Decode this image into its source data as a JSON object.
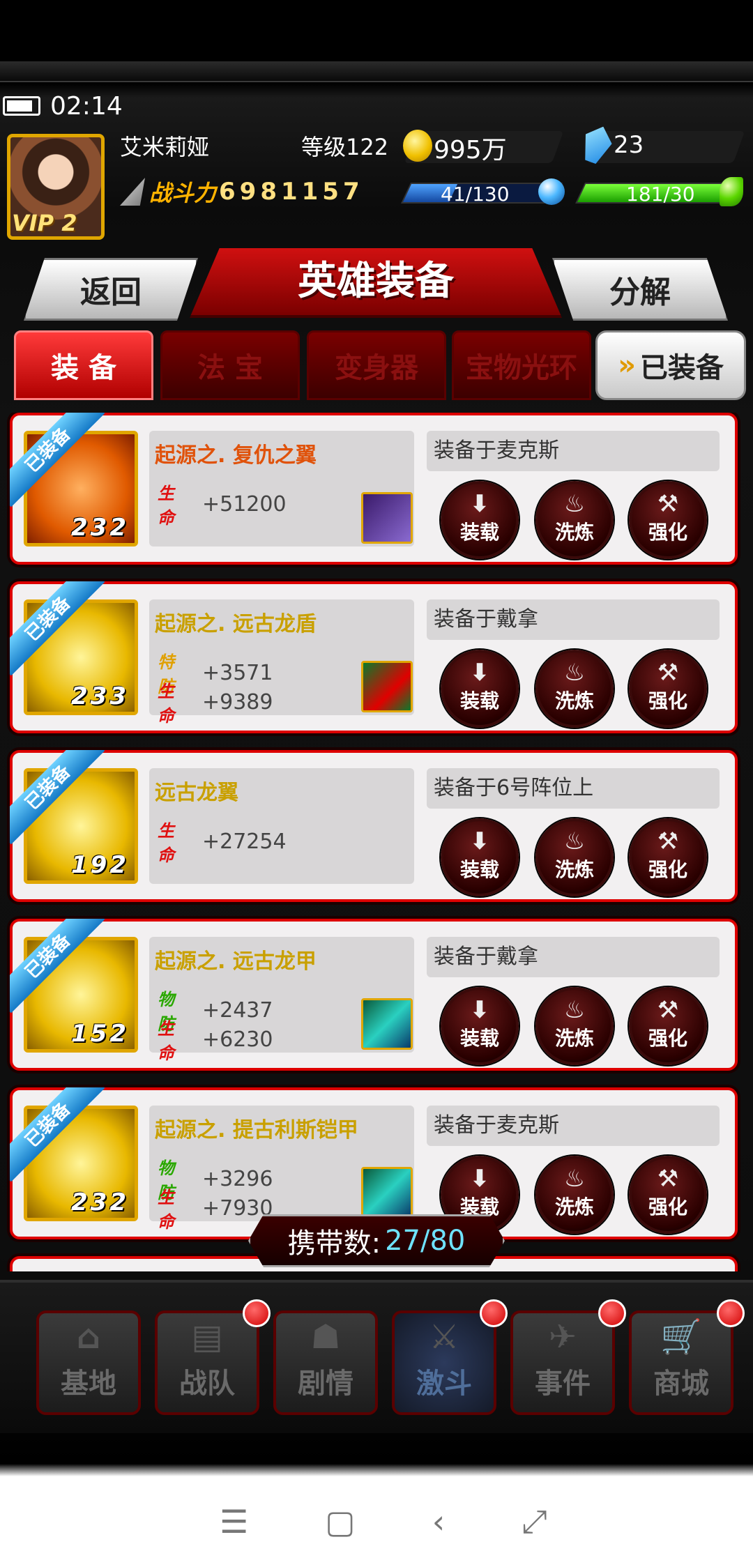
{
  "status": {
    "time": "02:14"
  },
  "player": {
    "name": "艾米莉娅",
    "level": "等级122",
    "vip": "VIP 2",
    "gold": "995万",
    "gems": "23",
    "power_label": "战斗力",
    "power_value": "6981157",
    "energy": "41/130",
    "energy_fraction": 0.31,
    "stamina": "181/30",
    "stamina_fraction": 1.0
  },
  "header": {
    "title": "英雄装备",
    "back": "返回",
    "decompose": "分解"
  },
  "tabs": [
    "装 备",
    "法 宝",
    "变身器",
    "宝物光环"
  ],
  "tab_equipped": "已装备",
  "actions": {
    "load": "装载",
    "wash": "洗炼",
    "strengthen": "强化"
  },
  "items": [
    {
      "badge": "已装备",
      "level": "232",
      "name": "起源之. 复仇之翼",
      "name_color": "#e0520a",
      "stats": [
        {
          "key": "生命",
          "type": "hp",
          "value": "+51200"
        }
      ],
      "equipped_on": "装备于麦克斯"
    },
    {
      "badge": "已装备",
      "level": "233",
      "name": "起源之. 远古龙盾",
      "name_color": "#c9a000",
      "stats": [
        {
          "key": "特防",
          "type": "sp",
          "value": "+3571"
        },
        {
          "key": "生命",
          "type": "hp",
          "value": "+9389"
        }
      ],
      "equipped_on": "装备于戴拿"
    },
    {
      "badge": "已装备",
      "level": "192",
      "name": "远古龙翼",
      "name_color": "#c9a000",
      "stats": [
        {
          "key": "生命",
          "type": "hp",
          "value": "+27254"
        }
      ],
      "equipped_on": "装备于6号阵位上"
    },
    {
      "badge": "已装备",
      "level": "152",
      "name": "起源之. 远古龙甲",
      "name_color": "#c9a000",
      "stats": [
        {
          "key": "物防",
          "type": "pd",
          "value": "+2437"
        },
        {
          "key": "生命",
          "type": "hp",
          "value": "+6230"
        }
      ],
      "equipped_on": "装备于戴拿"
    },
    {
      "badge": "已装备",
      "level": "232",
      "name": "起源之. 提古利斯铠甲",
      "name_color": "#c9a000",
      "stats": [
        {
          "key": "物防",
          "type": "pd",
          "value": "+3296"
        },
        {
          "key": "生命",
          "type": "hp",
          "value": "+7930"
        }
      ],
      "equipped_on": "装备于麦克斯"
    }
  ],
  "carry": {
    "label": "携带数:",
    "value": "27/80"
  },
  "nav": [
    {
      "label": "基地",
      "icon": "base-icon",
      "badge": false
    },
    {
      "label": "战队",
      "icon": "team-icon",
      "badge": true
    },
    {
      "label": "剧情",
      "icon": "story-icon",
      "badge": false
    },
    {
      "label": "激斗",
      "icon": "battle-icon",
      "badge": true
    },
    {
      "label": "事件",
      "icon": "event-icon",
      "badge": true
    },
    {
      "label": "商城",
      "icon": "cart-icon",
      "badge": true
    }
  ],
  "colors": {
    "accent_red": "#d00000",
    "gold": "#e0a600",
    "cyan": "#6fe3ff"
  }
}
